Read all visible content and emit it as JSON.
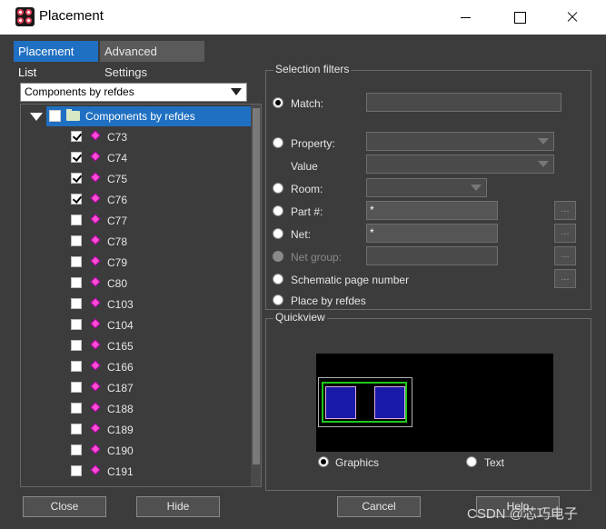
{
  "window": {
    "title": "Placement"
  },
  "tabs": [
    {
      "label": "Placement List",
      "active": true
    },
    {
      "label": "Advanced Settings",
      "active": false
    }
  ],
  "list_filter": {
    "selected": "Components by refdes"
  },
  "tree": {
    "root_label": "Components by refdes",
    "items": [
      {
        "label": "C73",
        "checked": true
      },
      {
        "label": "C74",
        "checked": true
      },
      {
        "label": "C75",
        "checked": true
      },
      {
        "label": "C76",
        "checked": true
      },
      {
        "label": "C77",
        "checked": false
      },
      {
        "label": "C78",
        "checked": false
      },
      {
        "label": "C79",
        "checked": false
      },
      {
        "label": "C80",
        "checked": false
      },
      {
        "label": "C103",
        "checked": false
      },
      {
        "label": "C104",
        "checked": false
      },
      {
        "label": "C165",
        "checked": false
      },
      {
        "label": "C166",
        "checked": false
      },
      {
        "label": "C187",
        "checked": false
      },
      {
        "label": "C188",
        "checked": false
      },
      {
        "label": "C189",
        "checked": false
      },
      {
        "label": "C190",
        "checked": false
      },
      {
        "label": "C191",
        "checked": false
      }
    ]
  },
  "selection_filters": {
    "title": "Selection filters",
    "match_label": "Match:",
    "match_value": "",
    "property_label": "Property:",
    "value_label": "Value",
    "room_label": "Room:",
    "part_label": "Part #:",
    "part_value": "*",
    "net_label": "Net:",
    "net_value": "*",
    "net_group_label": "Net group:",
    "schematic_label": "Schematic page number",
    "refdes_label": "Place by refdes",
    "ellipsis": "..."
  },
  "quickview": {
    "title": "Quickview",
    "graphics_label": "Graphics",
    "text_label": "Text",
    "mode": "Graphics"
  },
  "buttons": {
    "close": "Close",
    "hide": "Hide",
    "cancel": "Cancel",
    "help": "Help"
  },
  "watermark": "CSDN @芯巧电子",
  "colors": {
    "accent": "#1f70c2",
    "background": "#3c3c3c",
    "component": "#ff4dd2",
    "outline_green": "#1ec81e",
    "pad_blue": "#1a1aa8"
  }
}
